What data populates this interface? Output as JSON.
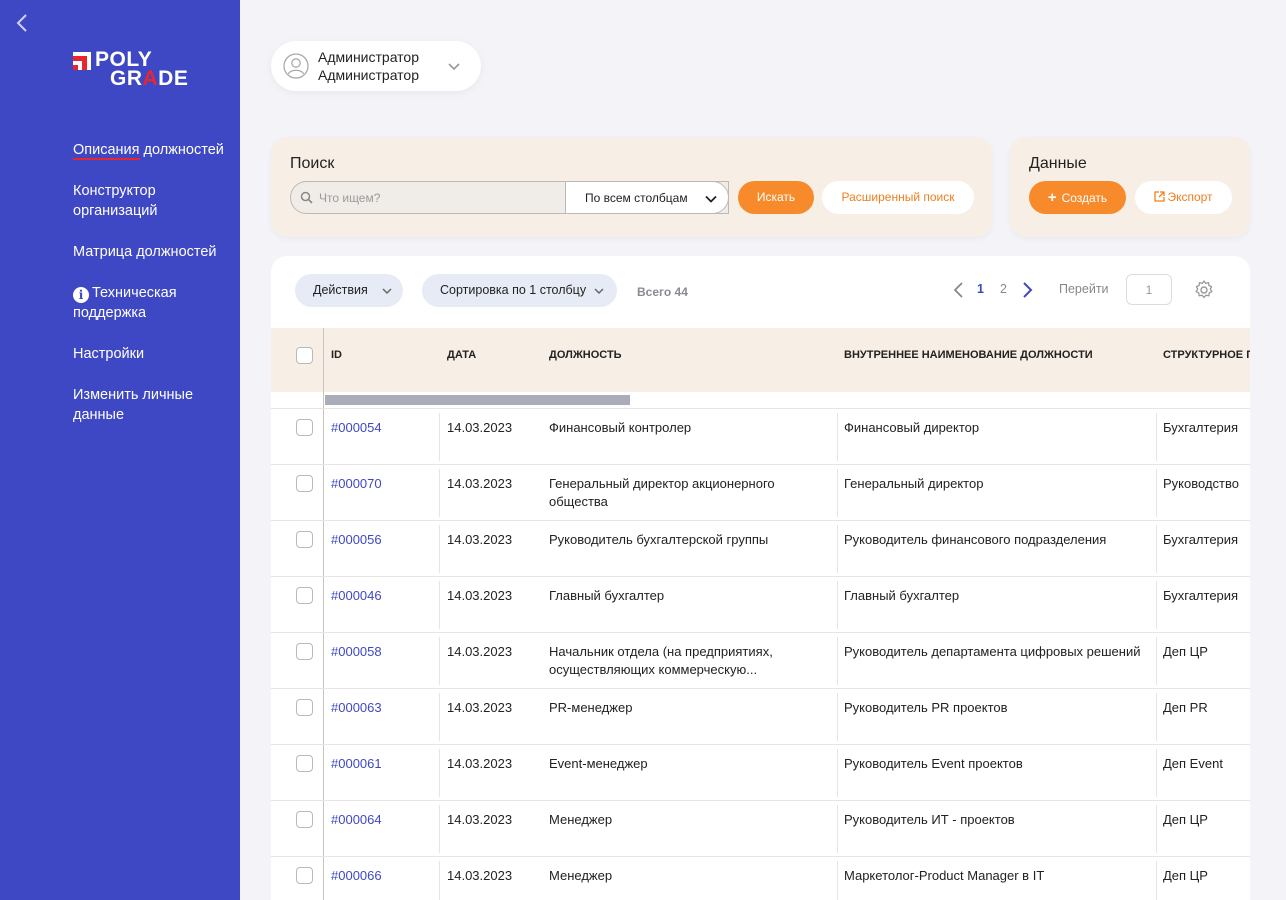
{
  "sidebar": {
    "logo": {
      "line1": "POLY",
      "line2_a": "GR",
      "line2_b": "A",
      "line2_c": "DE"
    },
    "items": [
      {
        "label_a": "Описания",
        "label_b": " должностей",
        "active": true
      },
      {
        "label": "Конструктор организаций"
      },
      {
        "label": "Матрица должностей"
      },
      {
        "label": "Техническая поддержка",
        "icon": "info-icon"
      },
      {
        "label": "Настройки"
      },
      {
        "label": "Изменить личные данные"
      }
    ]
  },
  "user": {
    "line1": "Администратор",
    "line2": "Администратор"
  },
  "search_panel": {
    "title": "Поиск",
    "placeholder": "Что ищем?",
    "column_select": "По всем столбцам",
    "search_button": "Искать",
    "advanced_button": "Расширенный поиск"
  },
  "data_panel": {
    "title": "Данные",
    "create_button": "Создать",
    "export_button": "Экспорт"
  },
  "toolbar": {
    "actions": "Действия",
    "sort": "Сортировка по 1 столбцу",
    "total": "Всего 44",
    "page1": "1",
    "page2": "2",
    "goto_label": "Перейти",
    "goto_value": "1"
  },
  "colors": {
    "sidebar": "#3f48c4",
    "accent": "#f78a2a",
    "panel": "#f7efe6",
    "logo_red": "#e8262e"
  },
  "table": {
    "columns": [
      "ID",
      "ДАТА",
      "ДОЛЖНОСТЬ",
      "ВНУТРЕННЕЕ НАИМЕНОВАНИЕ ДОЛЖНОСТИ",
      "СТРУКТУРНОЕ П"
    ],
    "rows": [
      {
        "id": "#000054",
        "date": "14.03.2023",
        "position": "Финансовый контролер",
        "internal": "Финансовый директор",
        "dept": "Бухгалтерия"
      },
      {
        "id": "#000070",
        "date": "14.03.2023",
        "position": "Генеральный директор акционерного общества",
        "internal": "Генеральный директор",
        "dept": "Руководство"
      },
      {
        "id": "#000056",
        "date": "14.03.2023",
        "position": "Руководитель бухгалтерской группы",
        "internal": "Руководитель финансового подразделения",
        "dept": "Бухгалтерия"
      },
      {
        "id": "#000046",
        "date": "14.03.2023",
        "position": "Главный бухгалтер",
        "internal": "Главный бухгалтер",
        "dept": "Бухгалтерия"
      },
      {
        "id": "#000058",
        "date": "14.03.2023",
        "position": "Начальник отдела (на предприятиях, осуществляющих коммерческую...",
        "internal": "Руководитель департамента цифровых решений",
        "dept": "Деп ЦР"
      },
      {
        "id": "#000063",
        "date": "14.03.2023",
        "position": "PR-менеджер",
        "internal": "Руководитель PR проектов",
        "dept": "Деп PR"
      },
      {
        "id": "#000061",
        "date": "14.03.2023",
        "position": "Event-менеджер",
        "internal": "Руководитель Event проектов",
        "dept": "Деп Event"
      },
      {
        "id": "#000064",
        "date": "14.03.2023",
        "position": "Менеджер",
        "internal": "Руководитель ИТ - проектов",
        "dept": "Деп ЦР"
      },
      {
        "id": "#000066",
        "date": "14.03.2023",
        "position": "Менеджер",
        "internal": "Маркетолог-Product Manager в IT",
        "dept": "Деп ЦР"
      }
    ]
  }
}
